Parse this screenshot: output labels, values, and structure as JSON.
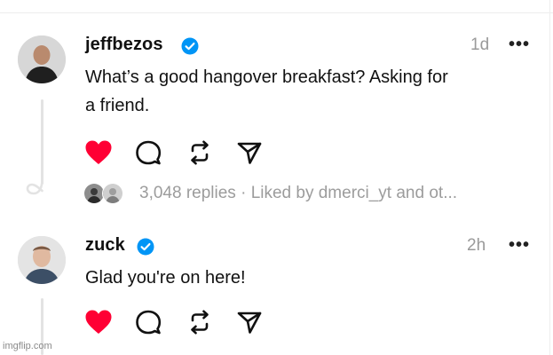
{
  "posts": [
    {
      "username": "jeffbezos",
      "verified": true,
      "time": "1d",
      "more": "•••",
      "text_lines": [
        "What’s a good hangover breakfast? Asking for",
        "a friend."
      ],
      "liked": true,
      "replies_text": "3,048 replies",
      "separator": "·",
      "liked_by_text": "Liked by dmerci_yt and ot..."
    },
    {
      "username": "zuck",
      "verified": true,
      "time": "2h",
      "more": "•••",
      "text_lines": [
        "Glad you're on here!"
      ],
      "liked": true
    }
  ],
  "icons": {
    "like": "heart-icon",
    "reply": "comment-icon",
    "repost": "repost-icon",
    "share": "send-icon",
    "verified": "verified-badge-icon",
    "more": "more-options-icon"
  },
  "colors": {
    "like_red": "#ff0034",
    "verified_blue": "#0095f6",
    "muted_text": "#9a9a9a"
  },
  "watermark": "imgflip.com"
}
